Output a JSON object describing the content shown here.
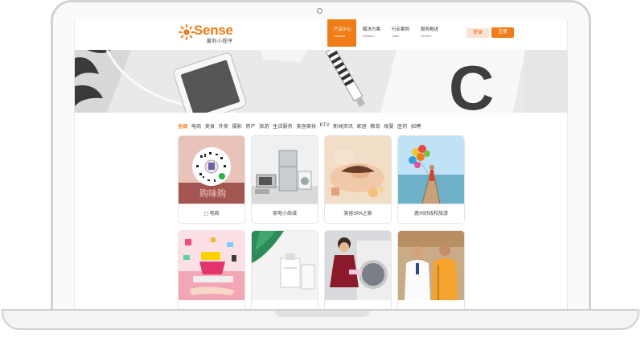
{
  "logo": {
    "name": "Sense",
    "subtitle": "赢利小程序"
  },
  "nav": [
    {
      "zh": "产品中心",
      "en": "Product",
      "active": true
    },
    {
      "zh": "解决方案",
      "en": "Solution",
      "active": false
    },
    {
      "zh": "行业案例",
      "en": "Case",
      "active": false
    },
    {
      "zh": "服务概述",
      "en": "Service",
      "active": false
    }
  ],
  "auth": {
    "login": "登录",
    "register": "注册"
  },
  "banner": {
    "letter": "C"
  },
  "categories": [
    "全部",
    "电商",
    "美食",
    "外卖",
    "摄影",
    "房产",
    "旅游",
    "生活服务",
    "美容美妆",
    "KTV",
    "新闻资讯",
    "家居",
    "教育",
    "母婴",
    "医药",
    "招聘"
  ],
  "cards_row1": [
    {
      "label": "电商",
      "overlay": "购味购"
    },
    {
      "label": "家电小商城"
    },
    {
      "label": "美容SPA之家"
    },
    {
      "label": "惠州好线和旅游"
    }
  ],
  "colors": {
    "accent": "#f07d17",
    "login_bg": "#fbe3d2"
  }
}
